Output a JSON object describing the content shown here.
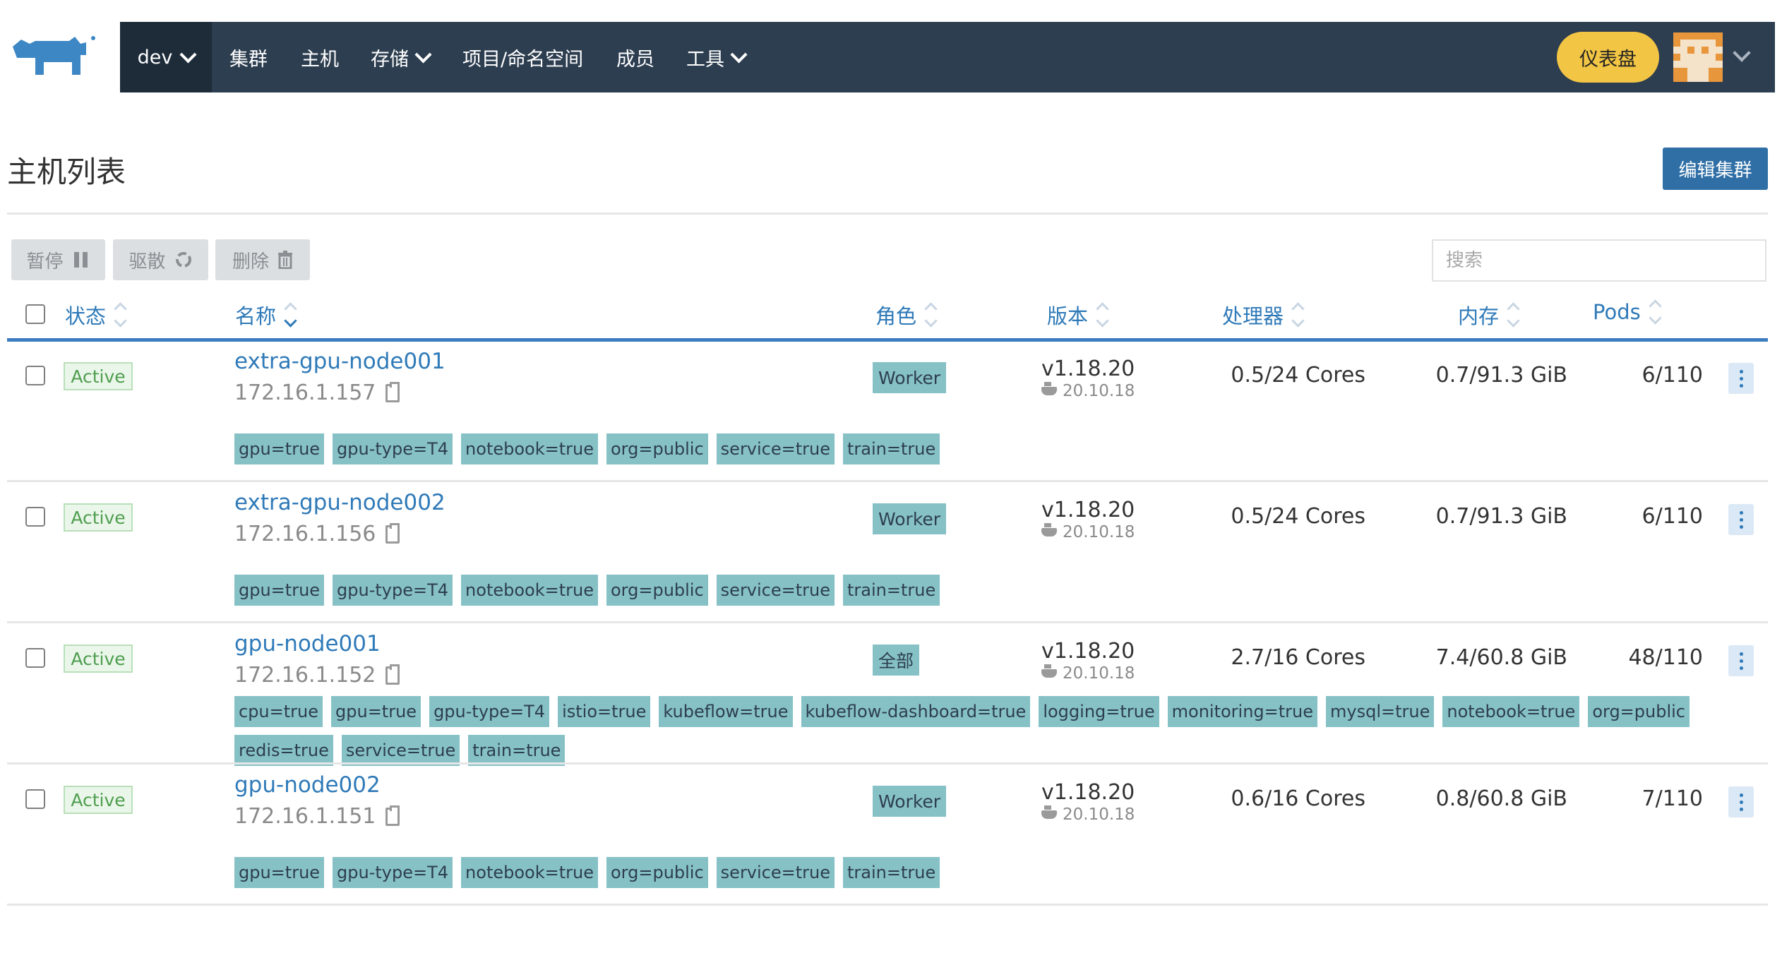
{
  "header": {
    "cluster": "dev",
    "nav": [
      {
        "label": "集群",
        "dropdown": false
      },
      {
        "label": "主机",
        "dropdown": false
      },
      {
        "label": "存储",
        "dropdown": true
      },
      {
        "label": "项目/命名空间",
        "dropdown": false
      },
      {
        "label": "成员",
        "dropdown": false
      },
      {
        "label": "工具",
        "dropdown": true
      }
    ],
    "dashboard_label": "仪表盘"
  },
  "page": {
    "title": "主机列表",
    "edit_cluster_label": "编辑集群"
  },
  "bulk_actions": {
    "pause": "暂停",
    "drain": "驱散",
    "delete": "删除"
  },
  "search": {
    "placeholder": "搜索",
    "value": ""
  },
  "columns": {
    "state": "状态",
    "name": "名称",
    "role": "角色",
    "version": "版本",
    "cpu": "处理器",
    "memory": "内存",
    "pods": "Pods"
  },
  "nodes": [
    {
      "state": "Active",
      "name": "extra-gpu-node001",
      "ip": "172.16.1.157",
      "role": "Worker",
      "k8s_version": "v1.18.20",
      "docker_version": "20.10.18",
      "cpu": "0.5/24 Cores",
      "memory": "0.7/91.3 GiB",
      "pods": "6/110",
      "labels": [
        "gpu=true",
        "gpu-type=T4",
        "notebook=true",
        "org=public",
        "service=true",
        "train=true"
      ]
    },
    {
      "state": "Active",
      "name": "extra-gpu-node002",
      "ip": "172.16.1.156",
      "role": "Worker",
      "k8s_version": "v1.18.20",
      "docker_version": "20.10.18",
      "cpu": "0.5/24 Cores",
      "memory": "0.7/91.3 GiB",
      "pods": "6/110",
      "labels": [
        "gpu=true",
        "gpu-type=T4",
        "notebook=true",
        "org=public",
        "service=true",
        "train=true"
      ]
    },
    {
      "state": "Active",
      "name": "gpu-node001",
      "ip": "172.16.1.152",
      "role": "全部",
      "k8s_version": "v1.18.20",
      "docker_version": "20.10.18",
      "cpu": "2.7/16 Cores",
      "memory": "7.4/60.8 GiB",
      "pods": "48/110",
      "labels": [
        "cpu=true",
        "gpu=true",
        "gpu-type=T4",
        "istio=true",
        "kubeflow=true",
        "kubeflow-dashboard=true",
        "logging=true",
        "monitoring=true",
        "mysql=true",
        "notebook=true",
        "org=public",
        "redis=true",
        "service=true",
        "train=true"
      ]
    },
    {
      "state": "Active",
      "name": "gpu-node002",
      "ip": "172.16.1.151",
      "role": "Worker",
      "k8s_version": "v1.18.20",
      "docker_version": "20.10.18",
      "cpu": "0.6/16 Cores",
      "memory": "0.8/60.8 GiB",
      "pods": "7/110",
      "labels": [
        "gpu=true",
        "gpu-type=T4",
        "notebook=true",
        "org=public",
        "service=true",
        "train=true"
      ]
    }
  ],
  "colors": {
    "nav_bg": "#2d3e50",
    "accent": "#2f7ab8",
    "dashboard_button": "#f3c544",
    "label_bg": "#86c1c6",
    "active_green": "#4f9e4f"
  },
  "icons": [
    "rancher-logo-icon",
    "chevron-down-icon",
    "pause-icon",
    "refresh-icon",
    "trash-icon",
    "copy-icon",
    "docker-icon",
    "kebab-menu-icon",
    "sort-icon"
  ]
}
